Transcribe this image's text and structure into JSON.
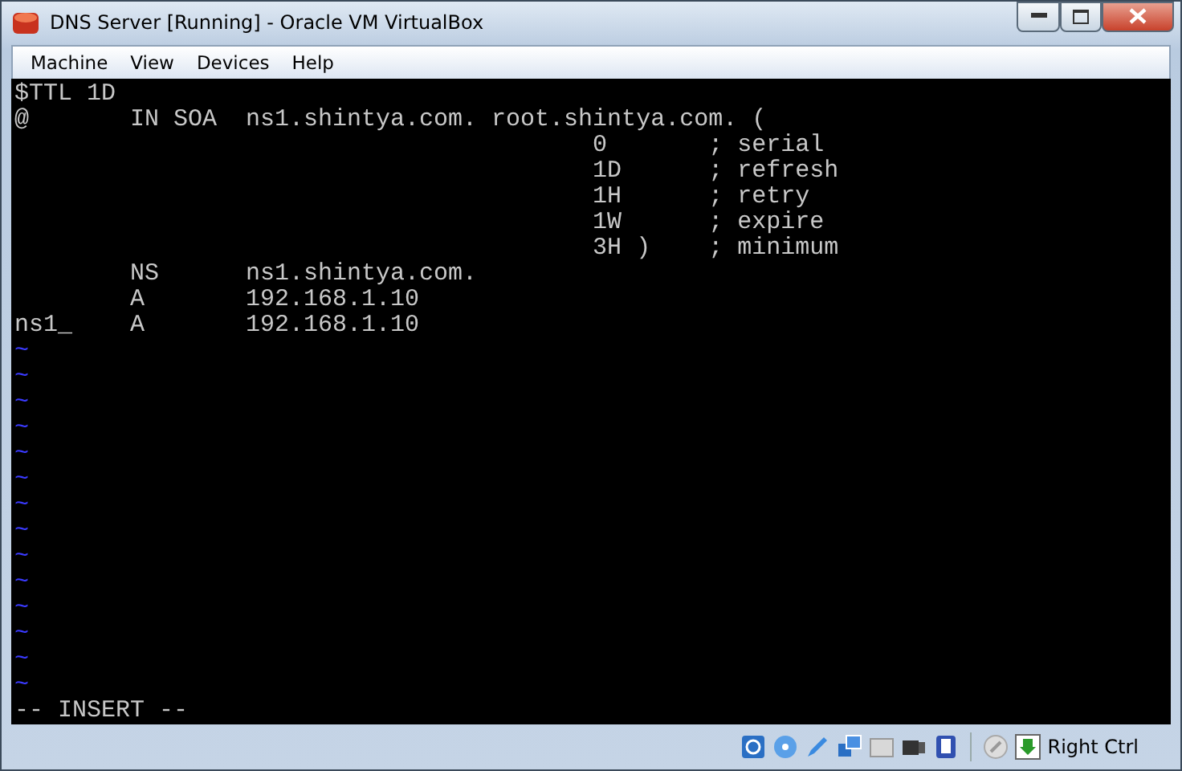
{
  "window": {
    "title": "DNS Server [Running] - Oracle VM VirtualBox"
  },
  "menu": [
    "Machine",
    "View",
    "Devices",
    "Help"
  ],
  "terminal": {
    "lines": [
      {
        "kind": "text",
        "text": "$TTL 1D"
      },
      {
        "kind": "text",
        "text": "@       IN SOA  ns1.shintya.com. root.shintya.com. ("
      },
      {
        "kind": "text",
        "text": "                                        0       ; serial"
      },
      {
        "kind": "text",
        "text": "                                        1D      ; refresh"
      },
      {
        "kind": "text",
        "text": "                                        1H      ; retry"
      },
      {
        "kind": "text",
        "text": "                                        1W      ; expire"
      },
      {
        "kind": "text",
        "text": "                                        3H )    ; minimum"
      },
      {
        "kind": "text",
        "text": "        NS      ns1.shintya.com."
      },
      {
        "kind": "text",
        "text": "        A       192.168.1.10"
      },
      {
        "kind": "text",
        "text": "ns1_    A       192.168.1.10"
      },
      {
        "kind": "tilde",
        "text": "~"
      },
      {
        "kind": "tilde",
        "text": "~"
      },
      {
        "kind": "tilde",
        "text": "~"
      },
      {
        "kind": "tilde",
        "text": "~"
      },
      {
        "kind": "tilde",
        "text": "~"
      },
      {
        "kind": "tilde",
        "text": "~"
      },
      {
        "kind": "tilde",
        "text": "~"
      },
      {
        "kind": "tilde",
        "text": "~"
      },
      {
        "kind": "tilde",
        "text": "~"
      },
      {
        "kind": "tilde",
        "text": "~"
      },
      {
        "kind": "tilde",
        "text": "~"
      },
      {
        "kind": "tilde",
        "text": "~"
      },
      {
        "kind": "tilde",
        "text": "~"
      },
      {
        "kind": "tilde",
        "text": "~"
      }
    ],
    "mode": "-- INSERT --"
  },
  "status_bar": {
    "host_key": "Right Ctrl"
  }
}
